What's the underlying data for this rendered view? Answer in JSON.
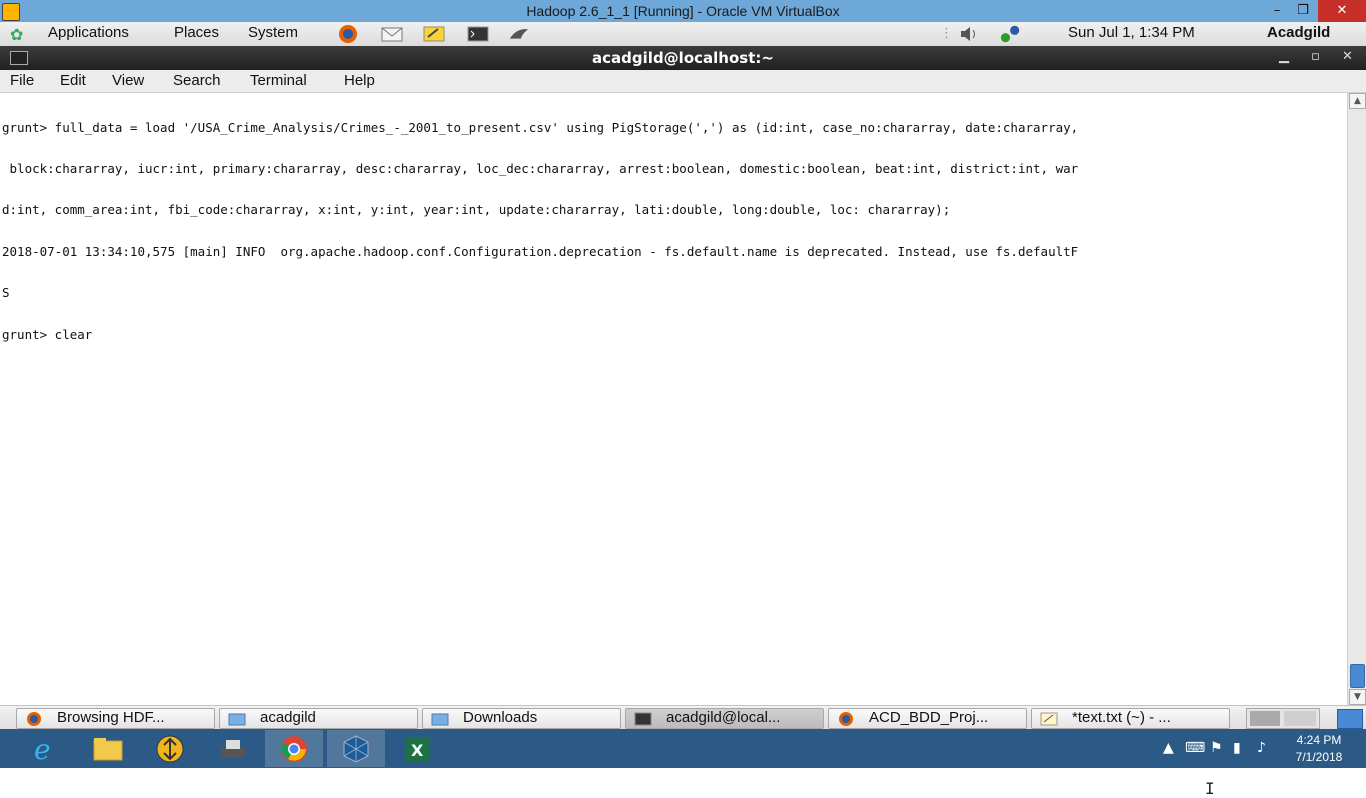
{
  "vbox": {
    "title": "Hadoop 2.6_1_1 [Running] - Oracle VM VirtualBox",
    "min": "–",
    "max": "❐",
    "close": "✕"
  },
  "top_panel": {
    "applications": "Applications",
    "places": "Places",
    "system": "System",
    "launchers": [
      "firefox-icon",
      "mail-icon",
      "notes-icon",
      "terminal-icon",
      "pidgin-icon"
    ],
    "clock": "Sun Jul  1,  1:34 PM",
    "user": "Acadgild"
  },
  "terminal": {
    "title": "acadgild@localhost:~",
    "menu": [
      "File",
      "Edit",
      "View",
      "Search",
      "Terminal",
      "Help"
    ],
    "lines": [
      "grunt> full_data = load '/USA_Crime_Analysis/Crimes_-_2001_to_present.csv' using PigStorage(',') as (id:int, case_no:chararray, date:chararray,",
      " block:chararray, iucr:int, primary:chararray, desc:chararray, loc_dec:chararray, arrest:boolean, domestic:boolean, beat:int, district:int, war",
      "d:int, comm_area:int, fbi_code:chararray, x:int, y:int, year:int, update:chararray, lati:double, long:double, loc: chararray);",
      "2018-07-01 13:34:10,575 [main] INFO  org.apache.hadoop.conf.Configuration.deprecation - fs.default.name is deprecated. Instead, use fs.defaultF",
      "S",
      "grunt> clear"
    ]
  },
  "bottom_panel": {
    "tasks": [
      {
        "label": "Browsing HDF...",
        "icon": "firefox-icon"
      },
      {
        "label": "acadgild",
        "icon": "home-folder-icon"
      },
      {
        "label": "Downloads",
        "icon": "folder-icon"
      },
      {
        "label": "acadgild@local...",
        "icon": "terminal-icon"
      },
      {
        "label": "ACD_BDD_Proj...",
        "icon": "firefox-icon"
      },
      {
        "label": "*text.txt (~) - ...",
        "icon": "text-editor-icon"
      }
    ]
  },
  "win_taskbar": {
    "apps": [
      "internet-explorer-icon",
      "file-explorer-icon",
      "app-icon",
      "scanner-icon",
      "chrome-icon",
      "virtualbox-icon",
      "excel-icon"
    ],
    "time": "4:24 PM",
    "date": "7/1/2018"
  },
  "colors": {
    "vbox_title_bg": "#6ea8d8",
    "close_red": "#c7302a",
    "win_taskbar_bg": "#2b5a86",
    "terminal_title_bg": "#2a2a2a"
  }
}
